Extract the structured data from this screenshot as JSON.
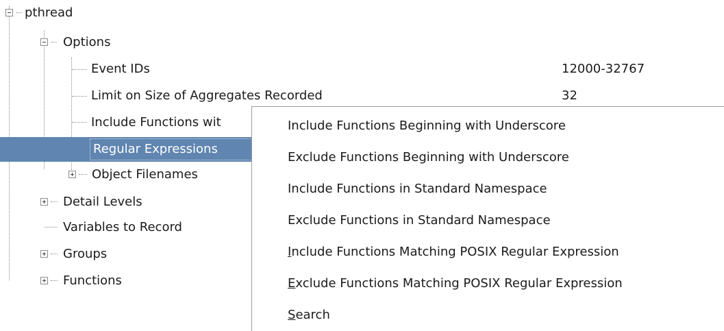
{
  "tree": {
    "root_label": "pthread",
    "options_label": "Options",
    "event_ids_label": "Event IDs",
    "event_ids_value": "12000-32767",
    "limit_size_label": "Limit on Size of Aggregates Recorded",
    "limit_size_value": "32",
    "include_functions_label": "Include Functions wit",
    "regular_expressions_label": "Regular Expressions",
    "object_filenames_label": "Object Filenames",
    "detail_levels_label": "Detail Levels",
    "variables_label": "Variables to Record",
    "groups_label": "Groups",
    "functions_label": "Functions"
  },
  "context_menu": {
    "items": [
      {
        "label": "Include Functions Beginning with Underscore"
      },
      {
        "label": "Exclude Functions Beginning with Underscore"
      },
      {
        "label": "Include Functions in Standard Namespace"
      },
      {
        "label": "Exclude Functions in Standard Namespace"
      },
      {
        "mnemonic": "I",
        "rest": "nclude Functions Matching POSIX Regular Expression"
      },
      {
        "mnemonic": "E",
        "rest": "xclude Functions Matching POSIX Regular Expression"
      },
      {
        "mnemonic": "S",
        "rest": "earch"
      }
    ]
  },
  "colors": {
    "selection": "#5f85b0",
    "selection_text": "#ffffff",
    "text": "#1a1a1a"
  }
}
